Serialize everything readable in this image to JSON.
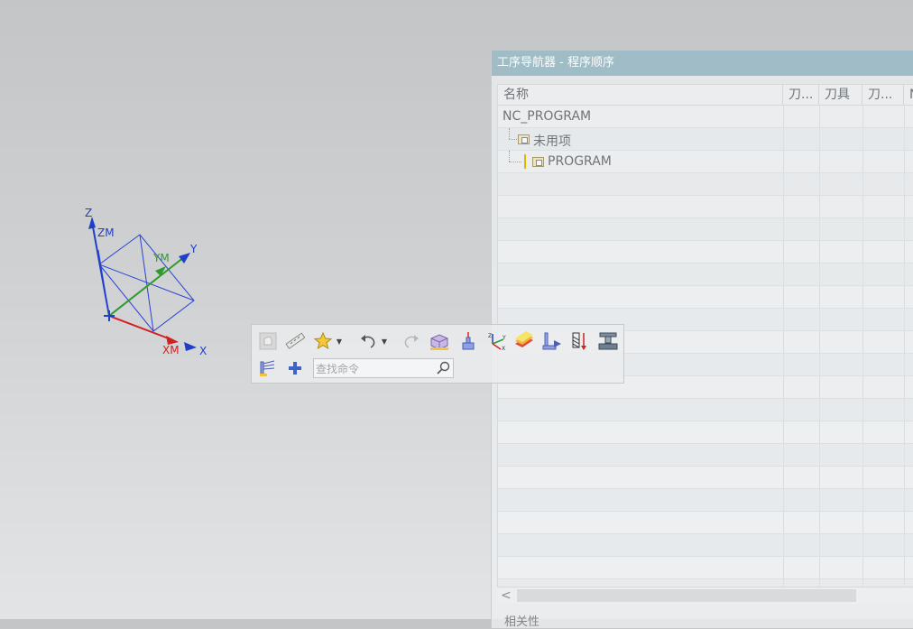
{
  "viewport": {
    "triad": {
      "z_label": "Z",
      "zm_label": "ZM",
      "y_label": "Y",
      "ym_label": "YM",
      "x_label": "X",
      "xm_label": "XM"
    },
    "colors": {
      "x_axis": "#d22020",
      "y_axis": "#2e9b2e",
      "z_axis": "#1f3fc9"
    }
  },
  "navigator": {
    "title": "工序导航器 - 程序顺序",
    "columns": [
      "名称",
      "刀...",
      "刀具",
      "刀...",
      "N"
    ],
    "rows": [
      {
        "name": "NC_PROGRAM",
        "level": 0,
        "icon": "none"
      },
      {
        "name": "未用项",
        "level": 1,
        "icon": "program-group-icon"
      },
      {
        "name": "PROGRAM",
        "level": 2,
        "icon": "program-group-icon"
      }
    ],
    "scroll_left_glyph": "<",
    "bottom_label": "相关性"
  },
  "toolbar": {
    "row1": [
      "disabled-part-icon",
      "measure-ruler-icon",
      "favorite-star-icon",
      "undo-icon",
      "redo-icon",
      "workpiece-icon",
      "geometry-mcs-icon",
      "csys-icon",
      "material-layer-icon",
      "tool-orient-icon",
      "toolpath-verify-icon",
      "machine-tool-icon"
    ],
    "row2": [
      "operation-tree-icon",
      "add-icon"
    ],
    "search_placeholder": "查找命令"
  }
}
